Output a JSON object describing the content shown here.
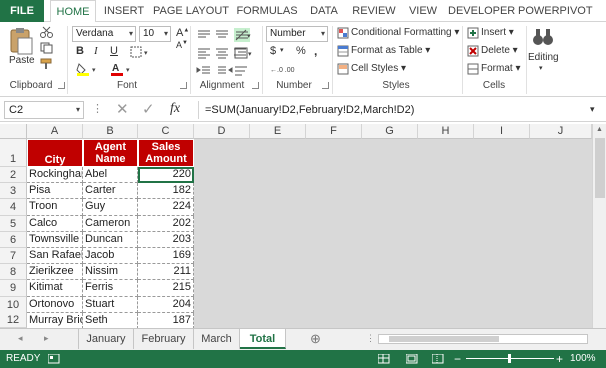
{
  "ribbon_tabs": [
    "FILE",
    "HOME",
    "INSERT",
    "PAGE LAYOUT",
    "FORMULAS",
    "DATA",
    "REVIEW",
    "VIEW",
    "DEVELOPER",
    "POWERPIVOT"
  ],
  "clipboard": {
    "paste": "Paste",
    "label": "Clipboard"
  },
  "font": {
    "name": "Verdana",
    "size": "10",
    "bold": "B",
    "italic": "I",
    "underline": "U",
    "label": "Font"
  },
  "alignment": {
    "label": "Alignment"
  },
  "number": {
    "format": "Number",
    "currency": "$",
    "percent": "%",
    "comma": ",",
    "label": "Number"
  },
  "styles": {
    "conditional": "Conditional Formatting",
    "format_table": "Format as Table",
    "cell_styles": "Cell Styles",
    "label": "Styles"
  },
  "cells": {
    "insert": "Insert",
    "delete": "Delete",
    "format": "Format",
    "label": "Cells"
  },
  "editing": {
    "label": "Editing"
  },
  "formula_bar": {
    "name_box": "C2",
    "cancel": "✕",
    "enter": "✓",
    "fx": "fx",
    "formula": "=SUM(January!D2,February!D2,March!D2)"
  },
  "columns": [
    "A",
    "B",
    "C",
    "D",
    "E",
    "F",
    "G",
    "H",
    "I",
    "J"
  ],
  "headers": {
    "city": "City",
    "agent_1": "Agent",
    "agent_2": "Name",
    "sales_1": "Sales",
    "sales_2": "Amount"
  },
  "rows": [
    {
      "row": "2",
      "city": "Rockinghan",
      "agent": "Abel",
      "amount": "220"
    },
    {
      "row": "3",
      "city": "Pisa",
      "agent": "Carter",
      "amount": "182"
    },
    {
      "row": "4",
      "city": "Troon",
      "agent": "Guy",
      "amount": "224"
    },
    {
      "row": "5",
      "city": "Calco",
      "agent": "Cameron",
      "amount": "202"
    },
    {
      "row": "6",
      "city": "Townsville",
      "agent": "Duncan",
      "amount": "203"
    },
    {
      "row": "7",
      "city": "San Rafael",
      "agent": "Jacob",
      "amount": "169"
    },
    {
      "row": "8",
      "city": "Zierikzee",
      "agent": "Nissim",
      "amount": "211"
    },
    {
      "row": "9",
      "city": "Kitimat",
      "agent": "Ferris",
      "amount": "215"
    },
    {
      "row": "10",
      "city": "Ortonovo",
      "agent": "Stuart",
      "amount": "204"
    },
    {
      "row": "11",
      "city": "Murray Brid",
      "agent": "Seth",
      "amount": "187"
    }
  ],
  "row_numbers": [
    "1",
    "12"
  ],
  "sheet_tabs": [
    "January",
    "February",
    "March",
    "Total"
  ],
  "active_sheet": "Total",
  "add_sheet": "⊕",
  "status": {
    "ready": "READY",
    "zoom": "100%",
    "zoom_out": "−",
    "zoom_in": "+"
  },
  "colors": {
    "accent": "#217346",
    "header_fill": "#c00000"
  }
}
